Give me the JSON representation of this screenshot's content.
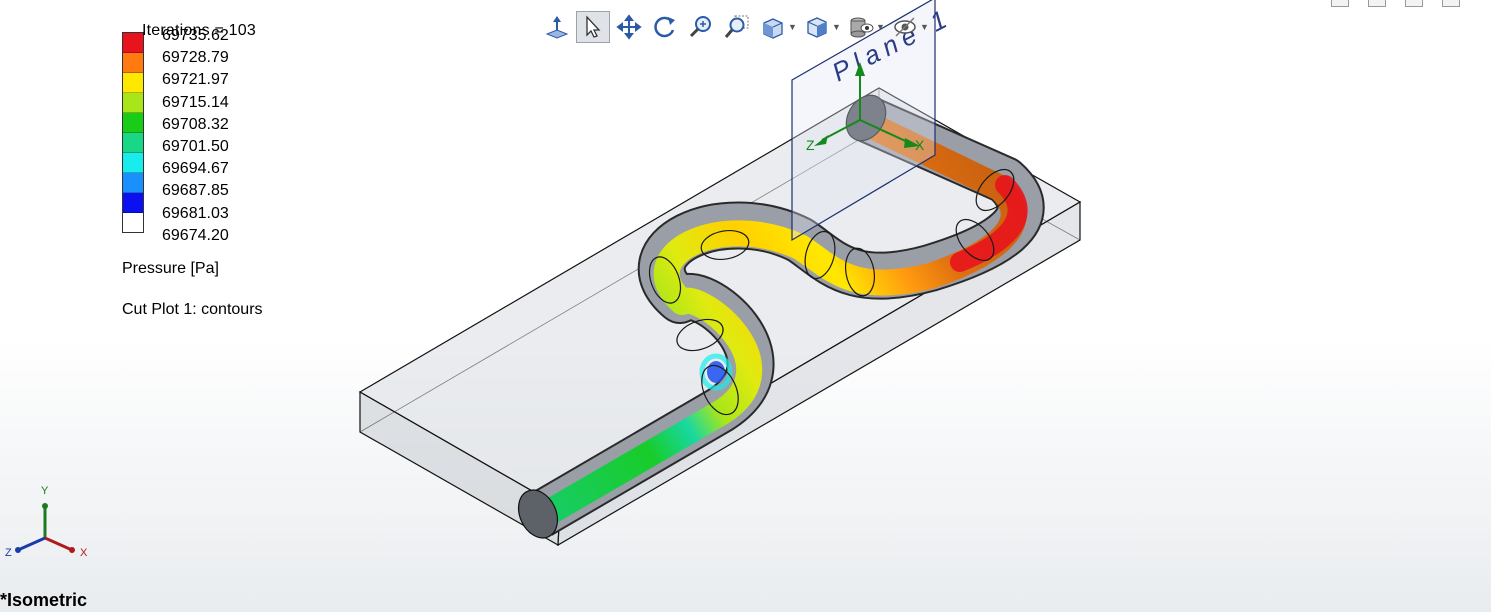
{
  "legend": {
    "overlay_text": "Iterations = 103",
    "values": [
      "69735.62",
      "69728.79",
      "69721.97",
      "69715.14",
      "69708.32",
      "69701.50",
      "69694.67",
      "69687.85",
      "69681.03",
      "69674.20"
    ],
    "colors": [
      "#e8141d",
      "#ff7a10",
      "#ffe800",
      "#a8e61a",
      "#18cc18",
      "#18d887",
      "#18ecec",
      "#1a90ff",
      "#0a10f0"
    ],
    "quantity_label": "Pressure [Pa]",
    "plot_label": "Cut Plot 1: contours"
  },
  "plane_label": "Plane 1",
  "view_label": "*Isometric",
  "triad": {
    "x": "X",
    "y": "Y",
    "z": "Z"
  },
  "toolbar": {
    "icons": [
      "normal-to-icon",
      "select-arrow-icon",
      "pan-icon",
      "rotate-icon",
      "zoom-in-out-icon",
      "zoom-to-area-icon",
      "view-orientation-icon",
      "display-style-icon",
      "hide-show-items-icon",
      "section-view-icon"
    ]
  }
}
